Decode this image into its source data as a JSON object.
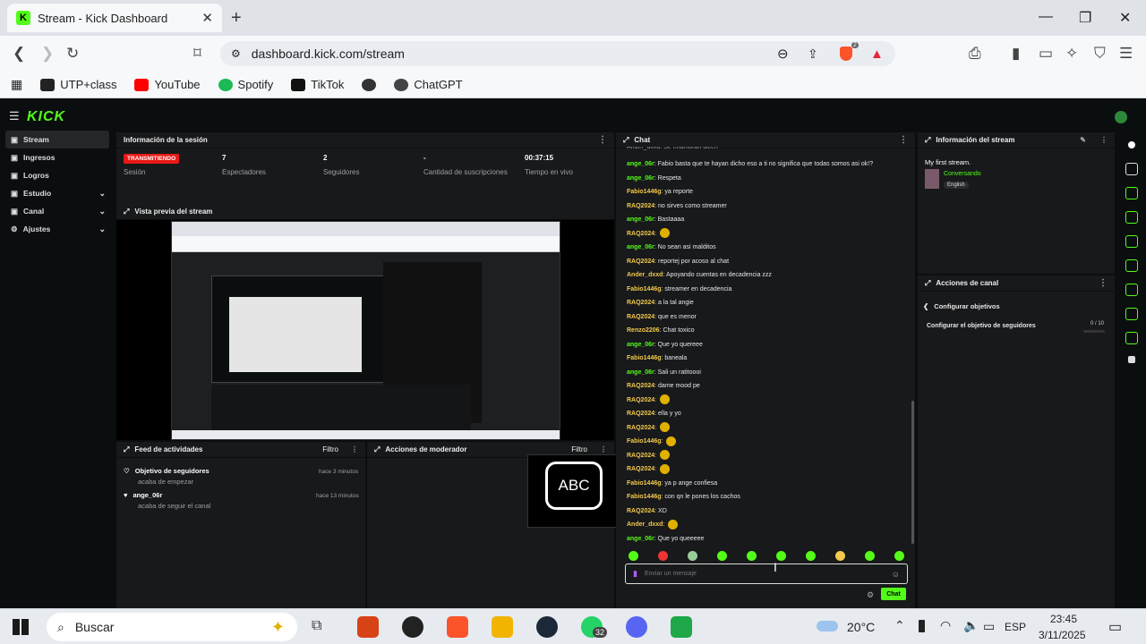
{
  "browser": {
    "tab_title": "Stream - Kick Dashboard",
    "url": "dashboard.kick.com/stream",
    "bookmarks": [
      "UTP+class",
      "YouTube",
      "Spotify",
      "TikTok",
      "ChatGPT"
    ],
    "brave_badge": "2"
  },
  "app": {
    "logo": "KICK",
    "sidebar": [
      {
        "label": "Stream",
        "icon": "video-icon"
      },
      {
        "label": "Ingresos",
        "icon": "dollar-icon"
      },
      {
        "label": "Logros",
        "icon": "trophy-icon"
      },
      {
        "label": "Estudio",
        "icon": "studio-icon"
      },
      {
        "label": "Canal",
        "icon": "channel-icon"
      },
      {
        "label": "Ajustes",
        "icon": "gear-icon"
      }
    ]
  },
  "session": {
    "title": "Información de la sesión",
    "status": "TRANSMITIENDO",
    "status_label": "Sesión",
    "viewers": "7",
    "viewers_label": "Espectadores",
    "followers": "2",
    "followers_label": "Seguidores",
    "subs": "-",
    "subs_label": "Cantidad de suscripciones",
    "time": "00:37:15",
    "time_label": "Tiempo en vivo"
  },
  "preview": {
    "title": "Vista previa del stream"
  },
  "activity": {
    "title": "Feed de actividades",
    "filter": "Filtro",
    "items": [
      {
        "title": "Objetivo de seguidores",
        "sub": "acaba de empezar",
        "time": "hace 3 minutos"
      },
      {
        "title": "ange_06r",
        "sub": "acaba de seguir el canal",
        "time": "hace 13 minutos"
      }
    ]
  },
  "moderator": {
    "title": "Acciones de moderador",
    "filter": "Filtro",
    "overlay": "ABC"
  },
  "chat": {
    "title": "Chat",
    "top_cut": "Ander_dxxd: Se enamoran dicen",
    "messages": [
      {
        "user": "ange_06r",
        "color": "#53fc18",
        "text": "Fabio basta que te hayan dicho eso a ti no significa que todas somos asi ok!?"
      },
      {
        "user": "ange_06r",
        "color": "#53fc18",
        "text": "Respeta"
      },
      {
        "user": "Fabio1446g",
        "color": "#f2c94c",
        "text": "ya reporte"
      },
      {
        "user": "RAQ2024",
        "color": "#f2c94c",
        "text": "no sirves como streamer"
      },
      {
        "user": "ange_06r",
        "color": "#53fc18",
        "text": "Bastaaaa"
      },
      {
        "user": "RAQ2024",
        "color": "#f2c94c",
        "text": ""
      },
      {
        "user": "ange_06r",
        "color": "#53fc18",
        "text": "No sean asi malditos"
      },
      {
        "user": "RAQ2024",
        "color": "#f2c94c",
        "text": "reportej por acoso al chat"
      },
      {
        "user": "Ander_dxxd",
        "color": "#f2c94c",
        "text": "Apoyando cuentas en decadencia zzz"
      },
      {
        "user": "Fabio1446g",
        "color": "#f2c94c",
        "text": "streamer en decadencia"
      },
      {
        "user": "RAQ2024",
        "color": "#f2c94c",
        "text": "a la tal angie"
      },
      {
        "user": "RAQ2024",
        "color": "#f2c94c",
        "text": "que es menor"
      },
      {
        "user": "Renzo2206",
        "color": "#f2c94c",
        "text": "Chat toxico"
      },
      {
        "user": "ange_06r",
        "color": "#53fc18",
        "text": "Que yo quereee"
      },
      {
        "user": "Fabio1446g",
        "color": "#f2c94c",
        "text": "baneala"
      },
      {
        "user": "ange_06r",
        "color": "#53fc18",
        "text": "Sali un ratitoooi"
      },
      {
        "user": "RAQ2024",
        "color": "#f2c94c",
        "text": "dame mood pe"
      },
      {
        "user": "RAQ2024",
        "color": "#f2c94c",
        "text": ""
      },
      {
        "user": "RAQ2024",
        "color": "#f2c94c",
        "text": "ella y yo"
      },
      {
        "user": "RAQ2024",
        "color": "#f2c94c",
        "text": ""
      },
      {
        "user": "Fabio1446g",
        "color": "#f2c94c",
        "text": ""
      },
      {
        "user": "RAQ2024",
        "color": "#f2c94c",
        "text": ""
      },
      {
        "user": "RAQ2024",
        "color": "#f2c94c",
        "text": ""
      },
      {
        "user": "Fabio1446g",
        "color": "#f2c94c",
        "text": "ya p ange confiesa"
      },
      {
        "user": "Fabio1446g",
        "color": "#f2c94c",
        "text": "con qn le pones los cachos"
      },
      {
        "user": "RAQ2024",
        "color": "#f2c94c",
        "text": "XD"
      },
      {
        "user": "Ander_dxxd",
        "color": "#f2c94c",
        "text": ""
      },
      {
        "user": "ange_06r",
        "color": "#53fc18",
        "text": "Que yo queeeee"
      }
    ],
    "placeholder": "Enviar un mensaje",
    "send": "Chat"
  },
  "stream_info": {
    "title": "Información del stream",
    "stream_title": "My first stream.",
    "category": "Conversando",
    "language": "English"
  },
  "channel_actions": {
    "title": "Acciones de canal",
    "back": "Configurar objetivos",
    "goal": "Configurar el objetivo de seguidores",
    "goal_progress": "0 / 10"
  },
  "taskbar": {
    "search": "Buscar",
    "weather": "20°C",
    "lang": "ESP",
    "time": "23:45",
    "date": "3/11/2025",
    "whatsapp_badge": "32"
  }
}
